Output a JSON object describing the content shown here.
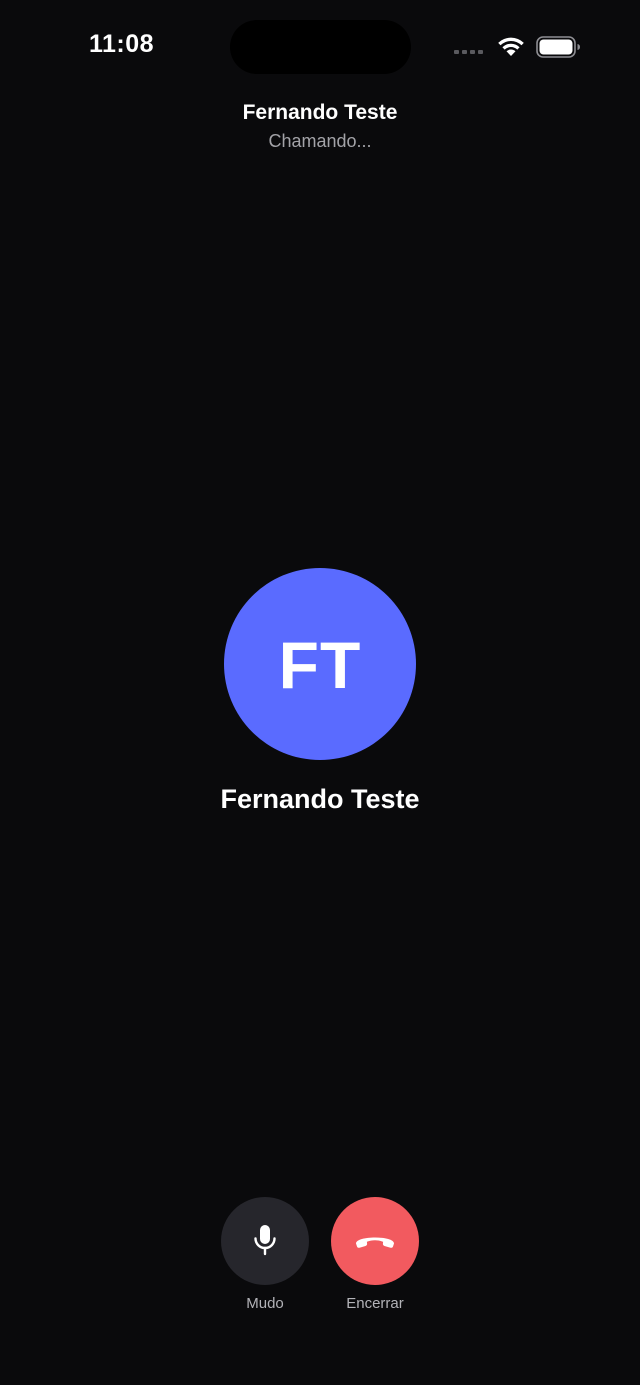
{
  "status_bar": {
    "time": "11:08",
    "icons": [
      "cellular-signal-icon",
      "wifi-icon",
      "battery-icon"
    ]
  },
  "header": {
    "name": "Fernando Teste",
    "status": "Chamando..."
  },
  "caller": {
    "initials": "FT",
    "name": "Fernando Teste",
    "avatar_color": "#5a6bff"
  },
  "controls": {
    "mute": {
      "label": "Mudo",
      "icon": "microphone-icon",
      "color": "#26262c"
    },
    "end": {
      "label": "Encerrar",
      "icon": "hang-up-icon",
      "color": "#f25a5f"
    }
  },
  "colors": {
    "background": "#0a0a0c",
    "text_primary": "#ffffff",
    "text_secondary": "#a3a3a8"
  }
}
